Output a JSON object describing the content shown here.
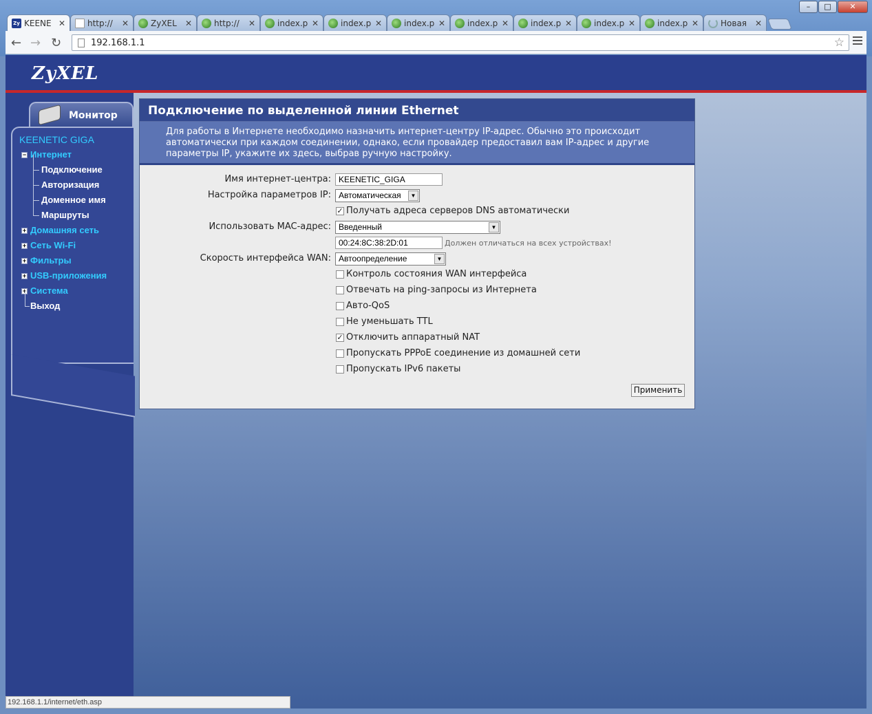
{
  "browser": {
    "tabs": [
      {
        "label": "KEENE",
        "icon": "zyxel-favicon",
        "active": true
      },
      {
        "label": "http://",
        "icon": "page-icon"
      },
      {
        "label": "ZyXEL",
        "icon": "globe-icon"
      },
      {
        "label": "http://",
        "icon": "globe-icon"
      },
      {
        "label": "index.p",
        "icon": "globe-icon"
      },
      {
        "label": "index.p",
        "icon": "globe-icon"
      },
      {
        "label": "index.p",
        "icon": "globe-icon"
      },
      {
        "label": "index.p",
        "icon": "globe-icon"
      },
      {
        "label": "index.p",
        "icon": "globe-icon"
      },
      {
        "label": "index.p",
        "icon": "globe-icon"
      },
      {
        "label": "index.p",
        "icon": "globe-icon"
      },
      {
        "label": "Новая",
        "icon": "loading-icon"
      }
    ],
    "url": "192.168.1.1",
    "status_url": "192.168.1.1/internet/eth.asp"
  },
  "header": {
    "logo": "ZyXEL"
  },
  "sidebar": {
    "monitor_label": "Монитор",
    "device": "KEENETIC GIGA",
    "items": [
      {
        "label": "Интернет",
        "expander": "−"
      },
      {
        "label": "Подключение"
      },
      {
        "label": "Авторизация"
      },
      {
        "label": "Доменное имя"
      },
      {
        "label": "Маршруты"
      },
      {
        "label": "Домашняя сеть",
        "expander": "+"
      },
      {
        "label": "Сеть Wi-Fi",
        "expander": "+"
      },
      {
        "label": "Фильтры",
        "expander": "+"
      },
      {
        "label": "USB-приложения",
        "expander": "+"
      },
      {
        "label": "Система",
        "expander": "+"
      },
      {
        "label": "Выход"
      }
    ]
  },
  "panel": {
    "title": "Подключение по выделенной линии Ethernet",
    "description": "Для работы в Интернете необходимо назначить интернет-центру IP-адрес. Обычно это происходит автоматически при каждом соединении, однако, если провайдер предоставил вам IP-адрес и другие параметры IP, укажите их здесь, выбрав ручную настройку.",
    "hostname_label": "Имя интернет-центра:",
    "hostname_value": "KEENETIC_GIGA",
    "ip_label": "Настройка параметров IP:",
    "ip_value": "Автоматическая",
    "dns_auto": "Получать адреса серверов DNS автоматически",
    "mac_label": "Использовать MAC-адрес:",
    "mac_mode": "Введенный",
    "mac_value": "00:24:8C:38:2D:01",
    "mac_hint": "Должен отличаться на всех устройствах!",
    "wan_label": "Скорость интерфейса WAN:",
    "wan_value": "Автоопределение",
    "options": [
      {
        "label": "Контроль состояния WAN интерфейса",
        "checked": false
      },
      {
        "label": "Отвечать на ping-запросы из Интернета",
        "checked": false
      },
      {
        "label": "Авто-QoS",
        "checked": false
      },
      {
        "label": "Не уменьшать TTL",
        "checked": false
      },
      {
        "label": "Отключить аппаратный NAT",
        "checked": true
      },
      {
        "label": "Пропускать PPPoE соединение из домашней сети",
        "checked": false
      },
      {
        "label": "Пропускать IPv6 пакеты",
        "checked": false
      }
    ],
    "apply_label": "Применить"
  }
}
